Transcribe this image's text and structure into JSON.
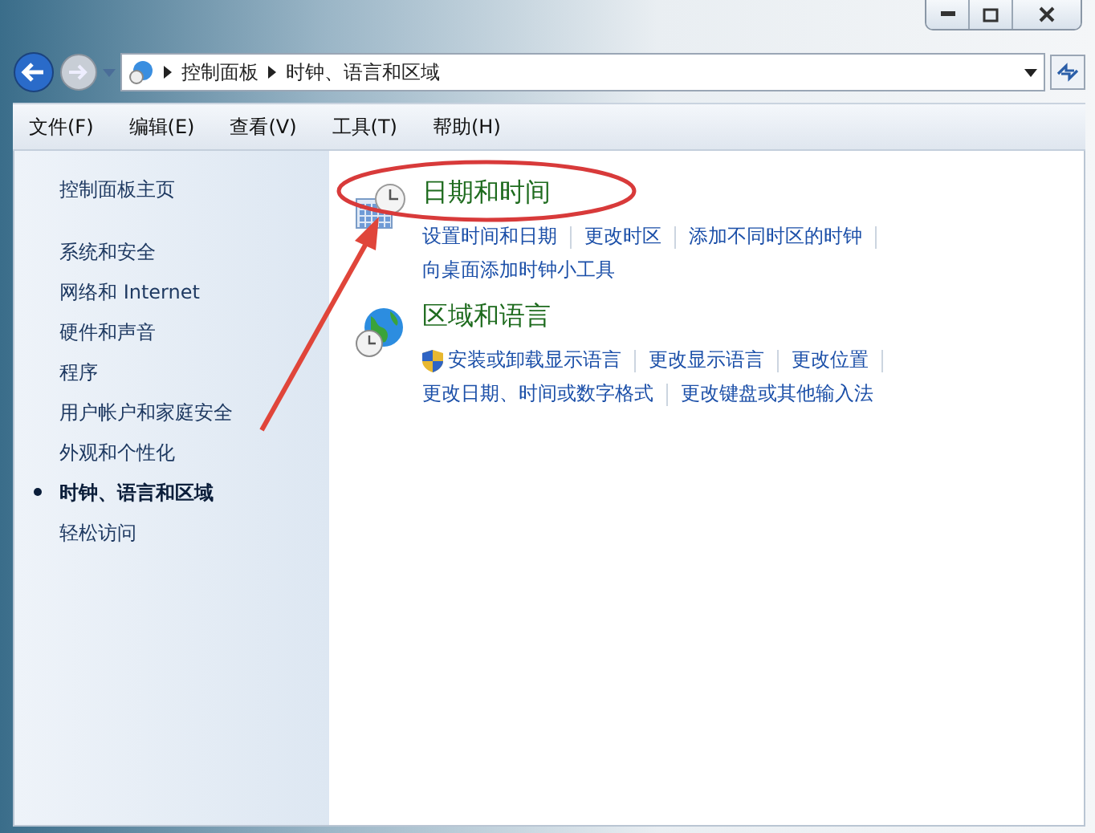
{
  "address_bar": {
    "breadcrumbs": [
      "控制面板",
      "时钟、语言和区域"
    ]
  },
  "menu_bar": [
    "文件(F)",
    "编辑(E)",
    "查看(V)",
    "工具(T)",
    "帮助(H)"
  ],
  "sidebar": {
    "home_link": "控制面板主页",
    "items": [
      {
        "label": "系统和安全",
        "selected": false
      },
      {
        "label": "网络和 Internet",
        "selected": false
      },
      {
        "label": "硬件和声音",
        "selected": false
      },
      {
        "label": "程序",
        "selected": false
      },
      {
        "label": "用户帐户和家庭安全",
        "selected": false
      },
      {
        "label": "外观和个性化",
        "selected": false
      },
      {
        "label": "时钟、语言和区域",
        "selected": true
      },
      {
        "label": "轻松访问",
        "selected": false
      }
    ]
  },
  "categories": [
    {
      "kind": "clock",
      "title": "日期和时间",
      "link_lines": [
        [
          {
            "text": "设置时间和日期",
            "admin": false
          },
          {
            "text": "更改时区",
            "admin": false
          },
          {
            "text": "添加不同时区的时钟",
            "admin": false
          }
        ],
        [
          {
            "text": "向桌面添加时钟小工具",
            "admin": false
          }
        ]
      ]
    },
    {
      "kind": "globe",
      "title": "区域和语言",
      "link_lines": [
        [
          {
            "text": "安装或卸载显示语言",
            "admin": true
          },
          {
            "text": "更改显示语言",
            "admin": false
          },
          {
            "text": "更改位置",
            "admin": false
          }
        ],
        [
          {
            "text": "更改日期、时间或数字格式",
            "admin": false
          },
          {
            "text": "更改键盘或其他输入法",
            "admin": false
          }
        ]
      ]
    }
  ]
}
